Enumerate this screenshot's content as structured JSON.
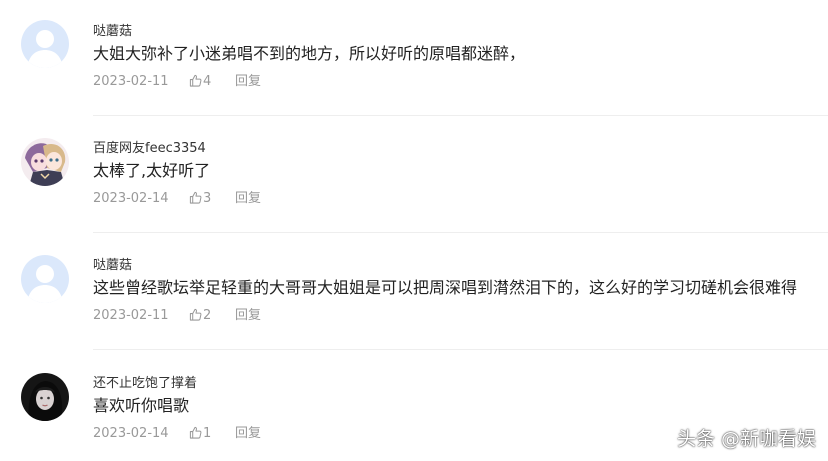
{
  "comments": [
    {
      "username": "哒蘑菇",
      "text": "大姐大弥补了小迷弟唱不到的地方，所以好听的原唱都迷醉，",
      "date": "2023-02-11",
      "likes": "4",
      "reply_label": "回复",
      "avatar": "default-avatar"
    },
    {
      "username": "百度网友feec3354",
      "text": "太棒了,太好听了",
      "date": "2023-02-14",
      "likes": "3",
      "reply_label": "回复",
      "avatar": "anime-avatar"
    },
    {
      "username": "哒蘑菇",
      "text": "这些曾经歌坛举足轻重的大哥哥大姐姐是可以把周深唱到潸然泪下的，这么好的学习切磋机会很难得",
      "date": "2023-02-11",
      "likes": "2",
      "reply_label": "回复",
      "avatar": "default-avatar"
    },
    {
      "username": "还不止吃饱了撑着",
      "text": "喜欢听你唱歌",
      "date": "2023-02-14",
      "likes": "1",
      "reply_label": "回复",
      "avatar": "photo-avatar"
    }
  ],
  "watermark": "头条 @新咖看娱",
  "colors": {
    "meta": "#999999",
    "divider": "#eeeeee",
    "default_avatar_bg": "#dbe8fb"
  }
}
